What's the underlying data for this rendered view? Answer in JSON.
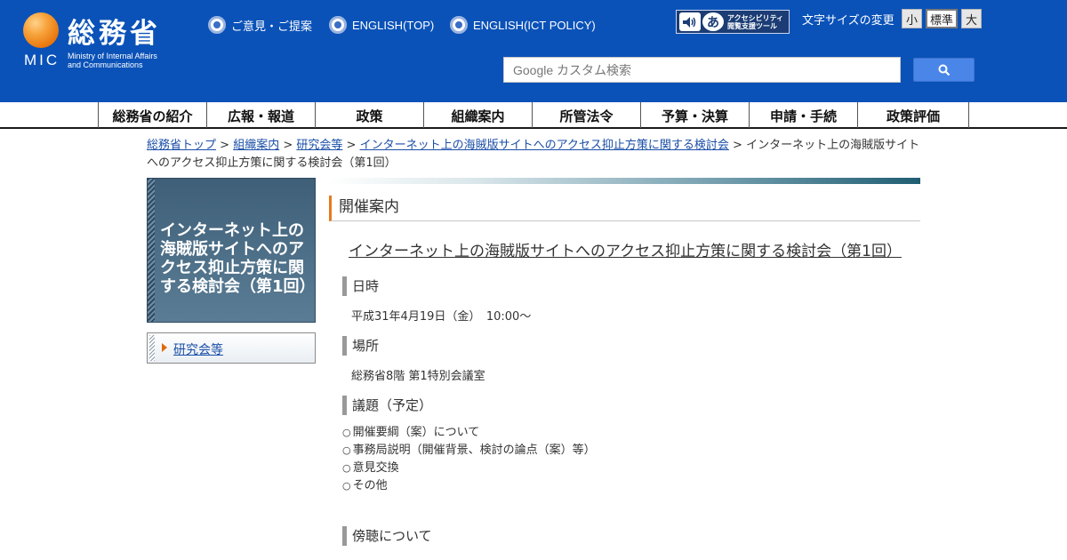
{
  "header": {
    "logo_jp": "総務省",
    "logo_abbr": "MIC",
    "logo_en_line1": "Ministry of Internal Affairs",
    "logo_en_line2": "and Communications",
    "top_links": [
      {
        "label": "ご意見・ご提案"
      },
      {
        "label": "ENGLISH(TOP)"
      },
      {
        "label": "ENGLISH(ICT POLICY)"
      }
    ],
    "access_tool": {
      "icon2": "あ",
      "line1": "アクセシビリティ",
      "line2": "閲覧支援ツール"
    },
    "fontsize_label": "文字サイズの変更",
    "fontsize_options": [
      "小",
      "標準",
      "大"
    ],
    "fontsize_selected": "標準",
    "search_placeholder": "Google カスタム検索",
    "search_value": ""
  },
  "gnav": {
    "items": [
      "総務省の紹介",
      "広報・報道",
      "政策",
      "組織案内",
      "所管法令",
      "予算・決算",
      "申請・手続",
      "政策評価"
    ]
  },
  "breadcrumb": {
    "links": [
      "総務省トップ",
      "組織案内",
      "研究会等",
      "インターネット上の海賊版サイトへのアクセス抑止方策に関する検討会"
    ],
    "separator": " > ",
    "current": "インターネット上の海賊版サイトへのアクセス抑止方策に関する検討会（第1回）"
  },
  "sidebar": {
    "title": "インターネット上の海賊版サイトへのアクセス抑止方策に関する検討会（第1回）",
    "link": "研究会等"
  },
  "main": {
    "section_title": "開催案内",
    "event_title": "インターネット上の海賊版サイトへのアクセス抑止方策に関する検討会（第1回）",
    "datetime_head": "日時",
    "datetime_value": "平成31年4月19日（金）　10:00～",
    "place_head": "場所",
    "place_value": "総務省8階 第1特別会議室",
    "agenda_head": "議題（予定）",
    "agenda_items": [
      "開催要綱（案）について",
      "事務局説明（開催背景、検討の論点（案）等）",
      "意見交換",
      "その他"
    ],
    "audience_head": "傍聴について"
  },
  "colors": {
    "header_bg": "#0a52b8",
    "accent": "#e87a1e",
    "link": "#1a4ea8"
  }
}
